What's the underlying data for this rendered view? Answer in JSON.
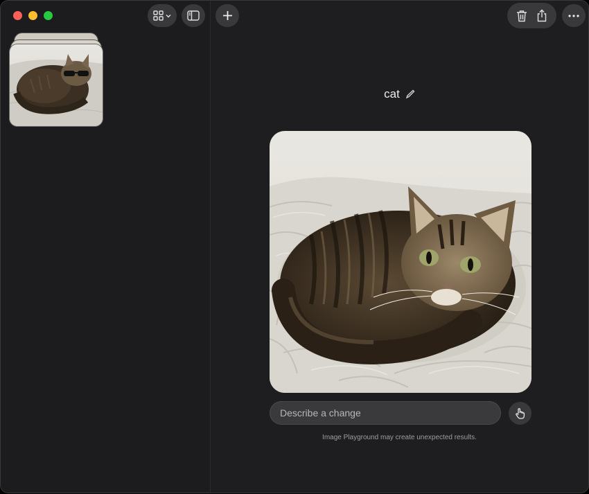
{
  "window": {
    "traffic_lights": [
      "close",
      "minimize",
      "zoom"
    ]
  },
  "toolbar": {
    "view_icon": "grid-icon",
    "view_menu_icon": "chevron-down-icon",
    "sidebar_icon": "sidebar-icon",
    "new_icon": "plus-icon",
    "delete_icon": "trash-icon",
    "share_icon": "share-icon",
    "more_icon": "ellipsis-icon"
  },
  "sidebar": {
    "items": [
      {
        "kind": "stack",
        "description_icon": "cat-with-sunglasses-thumbnail"
      }
    ]
  },
  "main": {
    "title": "cat",
    "edit_icon": "pencil-icon",
    "image_subject": "cat-on-knit-blanket",
    "prompt_placeholder": "Describe a change",
    "person_icon": "hand-point-icon",
    "disclaimer": "Image Playground may create unexpected results."
  },
  "colors": {
    "window_bg": "#1f1f21",
    "sidebar_bg": "#1c1c1e",
    "button_bg": "#39393b",
    "close": "#fe5f57",
    "minimize": "#febc2e",
    "zoom": "#28c840"
  }
}
